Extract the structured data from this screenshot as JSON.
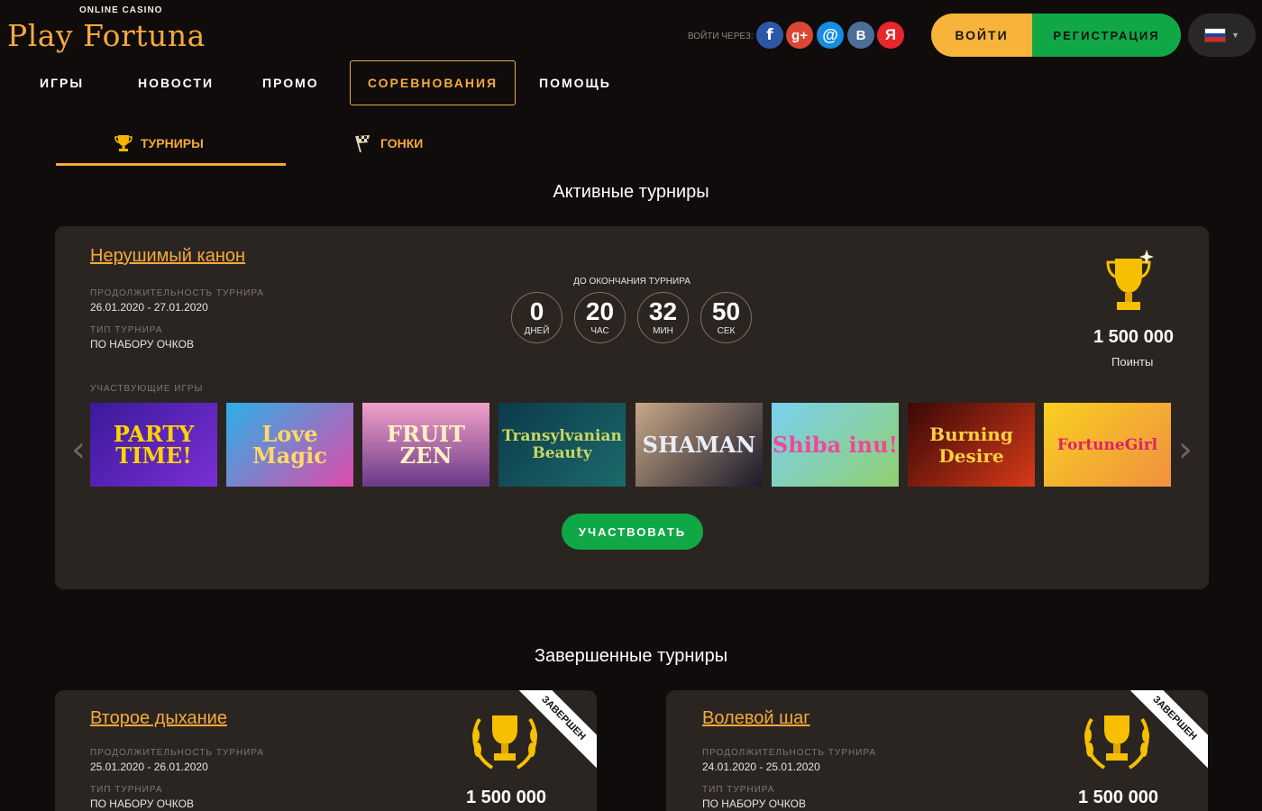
{
  "header": {
    "logo_sub": "ONLINE CASINO",
    "logo_main": "Play Fortuna",
    "social_label": "ВОЙТИ ЧЕРЕЗ:",
    "social": [
      {
        "icon": "facebook-icon",
        "glyph": "f"
      },
      {
        "icon": "google-plus-icon",
        "glyph": "g+"
      },
      {
        "icon": "mail-ru-icon",
        "glyph": "@"
      },
      {
        "icon": "vk-icon",
        "glyph": "В"
      },
      {
        "icon": "yandex-icon",
        "glyph": "Я"
      }
    ],
    "login_label": "ВОЙТИ",
    "register_label": "РЕГИСТРАЦИЯ",
    "language": "ru-flag-icon",
    "colors": {
      "accent": "#f6a93b",
      "login": "#f8b43a",
      "register": "#10a847"
    }
  },
  "nav": {
    "items": [
      "ИГРЫ",
      "НОВОСТИ",
      "ПРОМО",
      "СОРЕВНОВАНИЯ",
      "ПОМОЩЬ"
    ],
    "active": "СОРЕВНОВАНИЯ"
  },
  "subtabs": [
    {
      "label": "ТУРНИРЫ",
      "icon": "trophy-icon",
      "active": true
    },
    {
      "label": "ГОНКИ",
      "icon": "checkered-flag-icon",
      "active": false
    }
  ],
  "active_section": {
    "title": "Активные турниры",
    "tournament": {
      "name": "Нерушимый канон",
      "duration_label": "ПРОДОЛЖИТЕЛЬНОСТЬ ТУРНИРА",
      "duration": "26.01.2020 - 27.01.2020",
      "type_label": "ТИП ТУРНИРА",
      "type": "ПО НАБОРУ ОЧКОВ",
      "countdown_label": "ДО ОКОНЧАНИЯ ТУРНИРА",
      "countdown": [
        {
          "value": "0",
          "unit": "ДНЕЙ"
        },
        {
          "value": "20",
          "unit": "ЧАС"
        },
        {
          "value": "32",
          "unit": "МИН"
        },
        {
          "value": "50",
          "unit": "СЕК"
        }
      ],
      "prize": "1 500 000",
      "prize_unit": "Поинты",
      "games_label": "УЧАСТВУЮЩИЕ ИГРЫ",
      "games": [
        "PARTY TIME!",
        "Love Magic",
        "FRUIT ZEN",
        "Transylvanian Beauty",
        "SHAMAN",
        "Shiba inu!",
        "Burning Desire",
        "FortuneGirl"
      ],
      "join_label": "УЧАСТВОВАТЬ"
    }
  },
  "completed_section": {
    "title": "Завершенные турниры",
    "tournaments": [
      {
        "name": "Второе дыхание",
        "duration_label": "ПРОДОЛЖИТЕЛЬНОСТЬ ТУРНИРА",
        "duration": "25.01.2020 - 26.01.2020",
        "type_label": "ТИП ТУРНИРА",
        "type": "ПО НАБОРУ ОЧКОВ",
        "prize": "1 500 000",
        "status": "ЗАВЕРШЕН"
      },
      {
        "name": "Волевой шаг",
        "duration_label": "ПРОДОЛЖИТЕЛЬНОСТЬ ТУРНИРА",
        "duration": "24.01.2020 - 25.01.2020",
        "type_label": "ТИП ТУРНИРА",
        "type": "ПО НАБОРУ ОЧКОВ",
        "prize": "1 500 000",
        "status": "ЗАВЕРШЕН"
      }
    ]
  }
}
